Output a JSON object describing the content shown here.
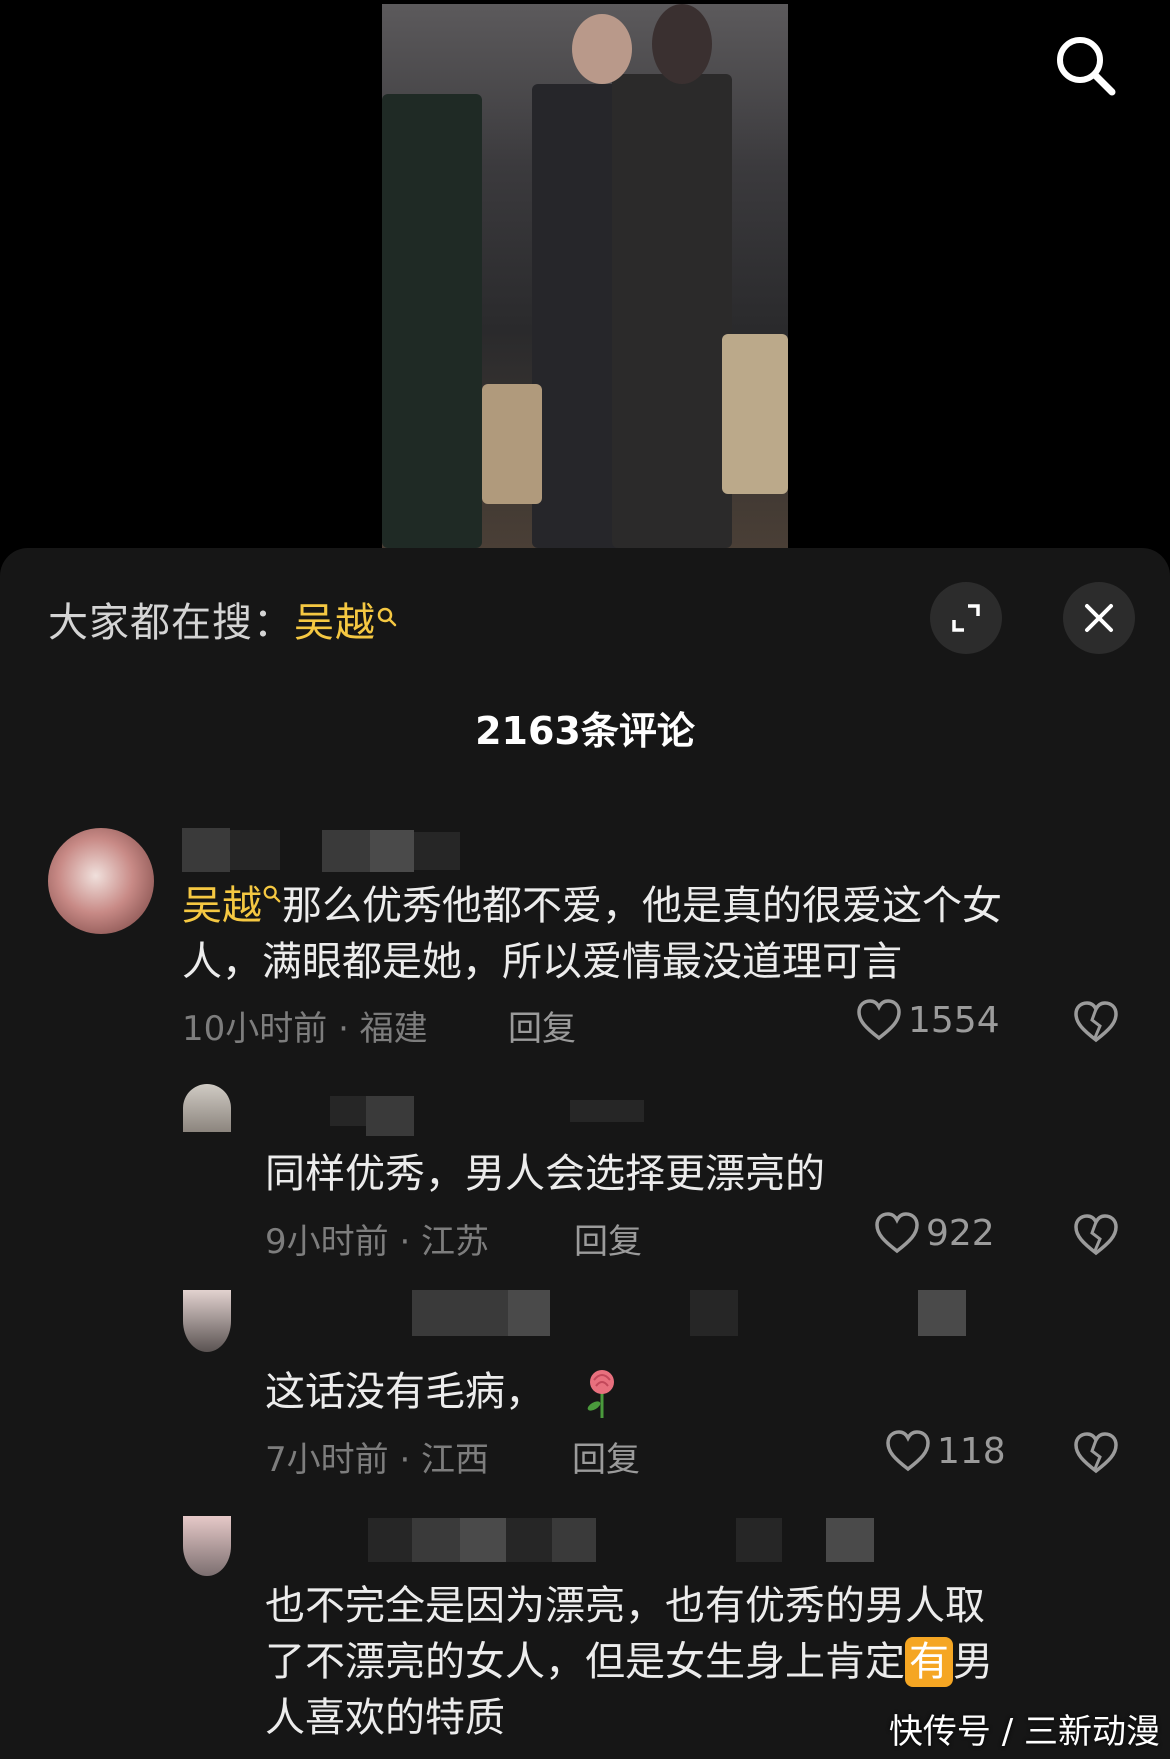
{
  "search_hint": {
    "prefix": "大家都在搜：",
    "keyword": "吴越"
  },
  "comment_count": "2163条评论",
  "comments": [
    {
      "mention": "吴越",
      "text_1": "那么优秀他都不爱，他是真的很爱这个女",
      "text_2": "人，满眼都是她，所以爱情最没道理可言",
      "meta": "10小时前 · 福建",
      "reply": "回复",
      "likes": "1554"
    },
    {
      "text_1": "同样优秀，男人会选择更漂亮的",
      "meta": "9小时前 · 江苏",
      "reply": "回复",
      "likes": "922"
    },
    {
      "text_1": "这话没有毛病，",
      "meta": "7小时前 · 江西",
      "reply": "回复",
      "likes": "118"
    },
    {
      "text_1": "也不完全是因为漂亮，也有优秀的男人取",
      "text_2_before": "了不漂亮的女人，但是女生身上肯定",
      "text_2_chip": "有",
      "text_2_after": "男",
      "text_3": "人喜欢的特质"
    }
  ],
  "watermark": "快传号 / 三新动漫",
  "icons": {
    "search": "search-icon",
    "expand": "expand-icon",
    "close": "close-icon",
    "like": "heart-icon",
    "dislike": "broken-heart-icon",
    "rose": "rose-icon"
  },
  "colors": {
    "accent": "#f5c842",
    "sheet": "#161616",
    "chip": "#f5a623"
  }
}
